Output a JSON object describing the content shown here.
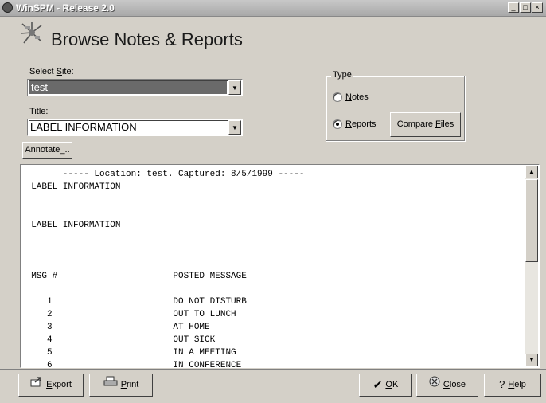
{
  "window": {
    "title": "WinSPM - Release 2.0",
    "controls": [
      "_",
      "□",
      "×"
    ]
  },
  "header": {
    "title": "Browse Notes & Reports",
    "icon": "satellite-dish-icon"
  },
  "form": {
    "select_site_label_pre": "Select ",
    "select_site_label_ul": "S",
    "select_site_label_post": "ite:",
    "site_value": "test",
    "title_label_ul": "T",
    "title_label_post": "itle:",
    "title_value": "LABEL INFORMATION",
    "annotate_pre": "Annotate",
    "annotate_ul": "_",
    "annotate_post": ".."
  },
  "type_group": {
    "legend": "Type",
    "notes_ul": "N",
    "notes_post": "otes",
    "reports_ul": "R",
    "reports_post": "eports",
    "selected": "Reports",
    "compare_pre": "Compare ",
    "compare_ul": "F",
    "compare_post": "iles"
  },
  "report": {
    "lines": [
      "        ----- Location: test. Captured: 8/5/1999 -----",
      "  LABEL INFORMATION",
      "",
      "",
      "  LABEL INFORMATION",
      "",
      "",
      "",
      "  MSG #                      POSTED MESSAGE",
      "",
      "     1                       DO NOT DISTURB",
      "     2                       OUT TO LUNCH",
      "     3                       AT HOME",
      "     4                       OUT SICK",
      "     5                       IN A MEETING",
      "     6                       IN CONFERENCE"
    ]
  },
  "footer": {
    "export_ul": "E",
    "export_post": "xport",
    "print_ul": "P",
    "print_post": "rint",
    "ok_ul": "O",
    "ok_post": "K",
    "close_ul": "C",
    "close_post": "lose",
    "help_ul": "H",
    "help_post": "elp"
  }
}
